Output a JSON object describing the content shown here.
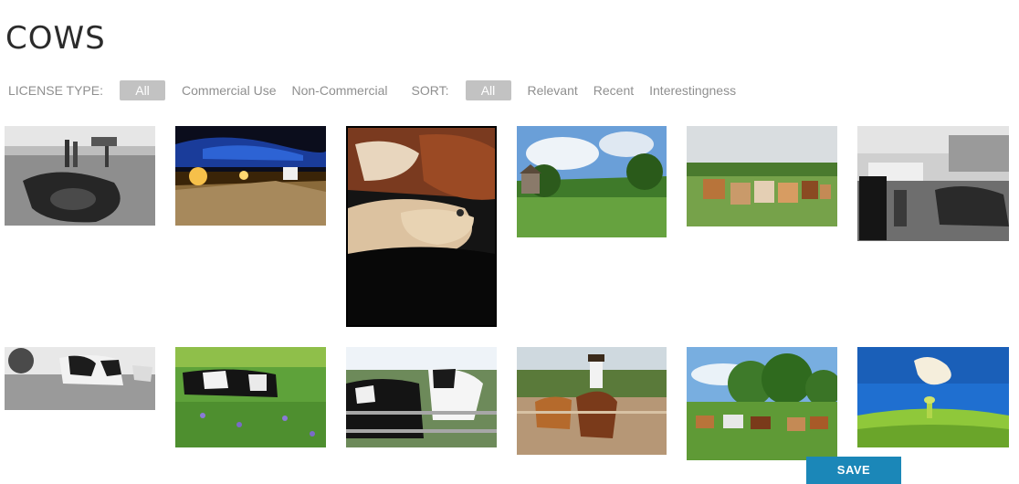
{
  "page": {
    "title": "COWS"
  },
  "filters": {
    "license_label": "LICENSE TYPE:",
    "license_options": [
      "All",
      "Commercial Use",
      "Non-Commercial"
    ],
    "license_selected": "All",
    "sort_label": "SORT:",
    "sort_options": [
      "All",
      "Relevant",
      "Recent",
      "Interestingness"
    ],
    "sort_selected": "All"
  },
  "save_label": "SAVE",
  "colors": {
    "pill_active": "#c2c2c2",
    "save_button": "#1b87b8",
    "filter_text": "#8f8f8f"
  }
}
